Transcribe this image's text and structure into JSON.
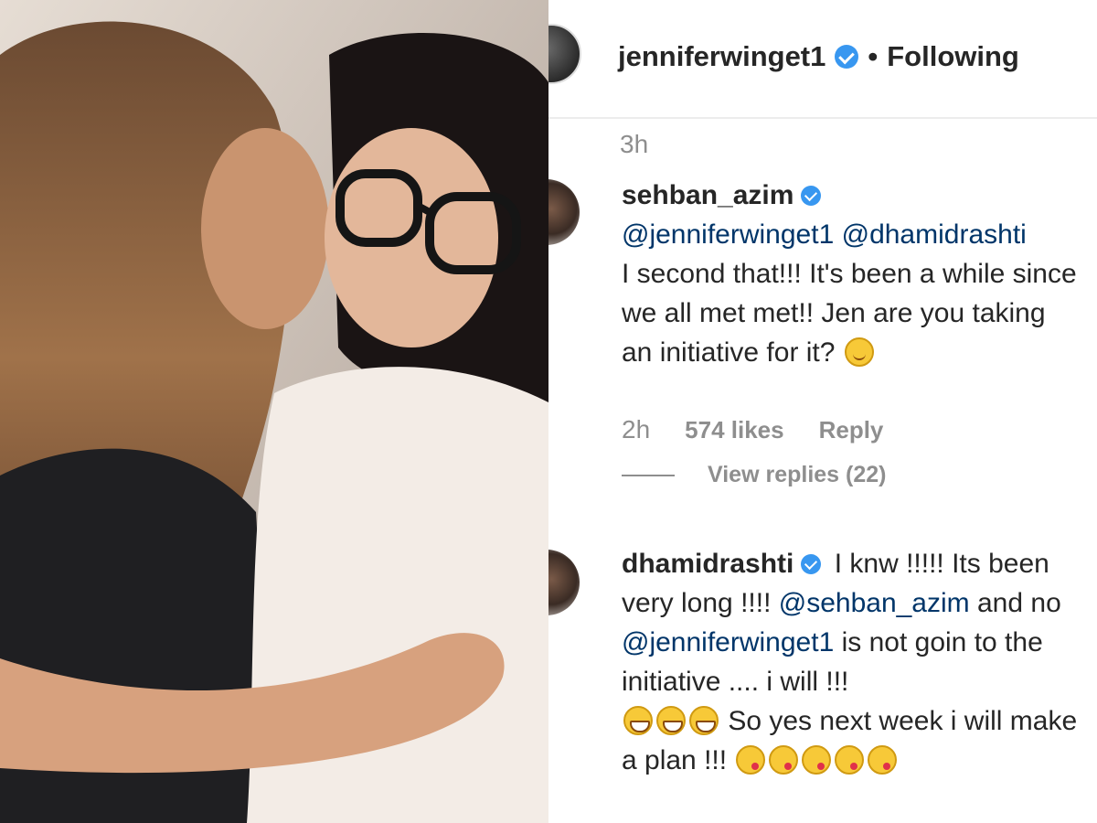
{
  "photo": {
    "description_icon": "photo-of-two-women-hugging"
  },
  "header": {
    "username": "jenniferwinget1",
    "separator": "•",
    "follow_status": "Following"
  },
  "comments": {
    "previous_time": "3h",
    "items": [
      {
        "username": "sehban_azim",
        "mentions": [
          "@jenniferwinget1",
          "@dhamidrashti"
        ],
        "text": "I second that!!! It's been a while since we all met met!! Jen are you taking an initiative for it?",
        "emoji": "smiling-face",
        "time": "2h",
        "likes": "574 likes",
        "reply_label": "Reply",
        "view_replies": "View replies (22)"
      },
      {
        "username": "dhamidrashti",
        "text_part1": "I knw !!!!! Its been very long !!!!",
        "mention1": "@sehban_azim",
        "text_part2": "and no",
        "mention2": "@jenniferwinget1",
        "text_part3": "is not goin to the initiative .... i will !!!",
        "text_part4": "So yes next week i will make a plan !!!",
        "emoji_grin": "grinning-face",
        "emoji_kiss": "face-blowing-kiss"
      }
    ]
  },
  "colors": {
    "verified": "#3897f0",
    "mention": "#003569",
    "meta": "#8e8e8e",
    "text": "#262626"
  }
}
